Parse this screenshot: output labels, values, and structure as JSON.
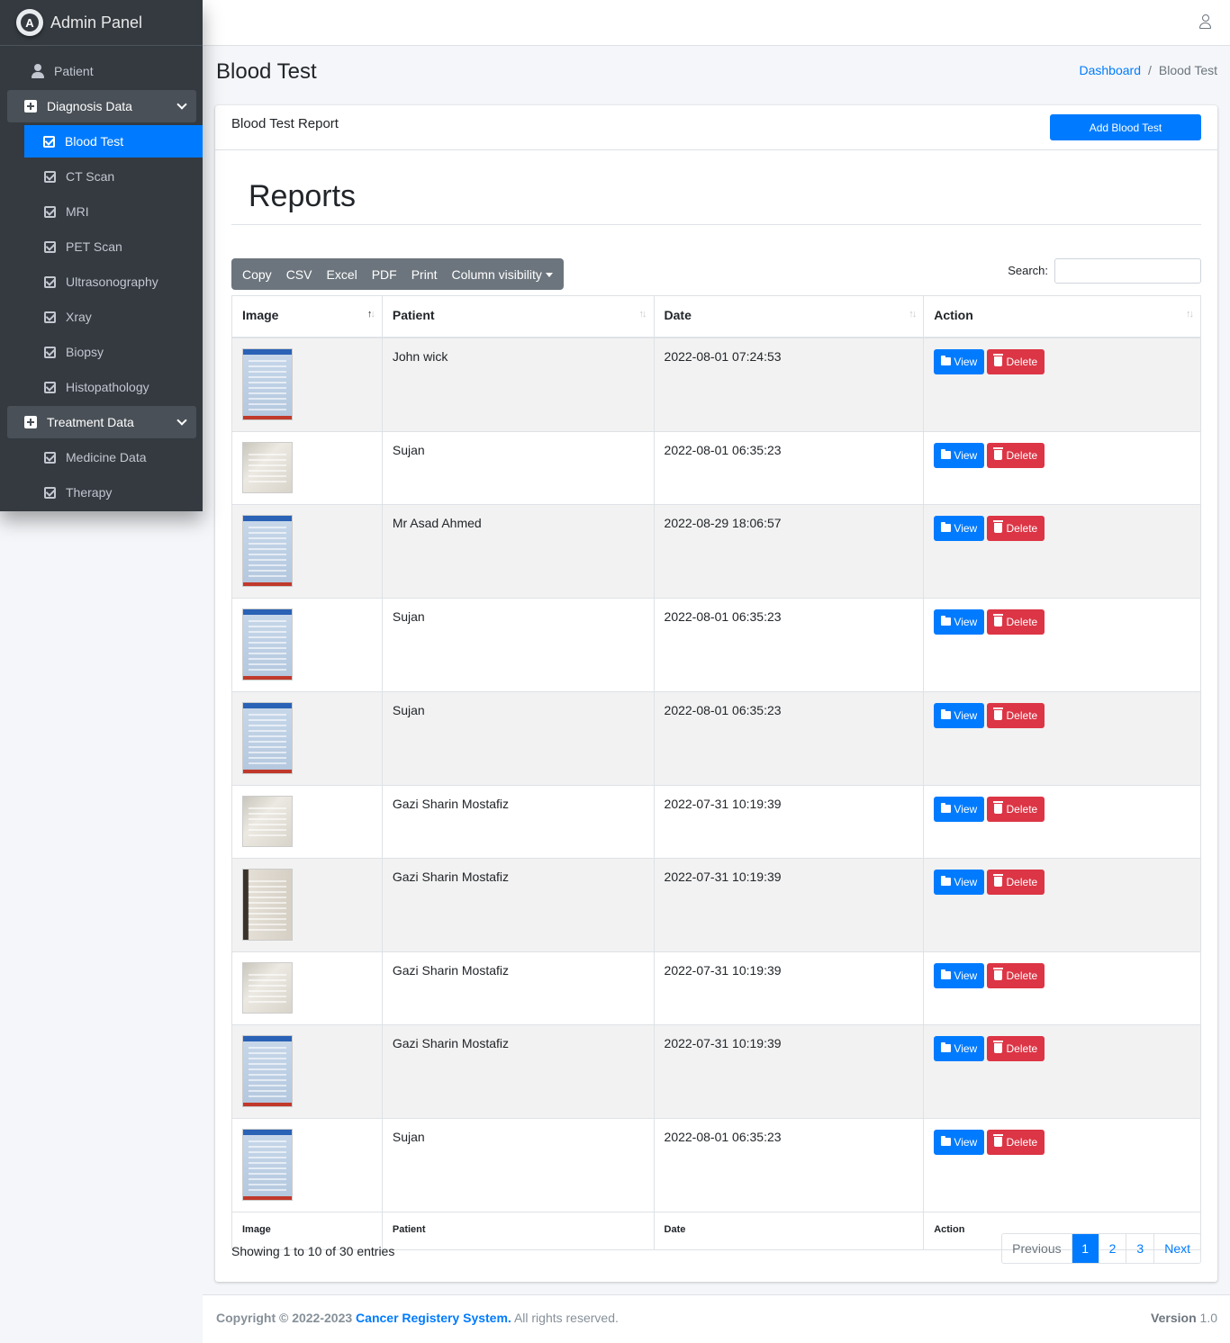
{
  "brand": {
    "name": "Admin Panel",
    "logo_letter": "A"
  },
  "sidebar": {
    "patient": "Patient",
    "diagnosis_header": "Diagnosis Data",
    "diagnosis_items": [
      "Blood Test",
      "CT Scan",
      "MRI",
      "PET Scan",
      "Ultrasonography",
      "Xray",
      "Biopsy",
      "Histopathology"
    ],
    "treatment_header": "Treatment Data",
    "treatment_items": [
      "Medicine Data",
      "Therapy"
    ]
  },
  "header": {
    "title": "Blood Test",
    "breadcrumb": {
      "home": "Dashboard",
      "sep": "/",
      "current": "Blood Test"
    }
  },
  "card": {
    "title": "Blood Test Report",
    "add_button": "Add Blood Test",
    "reports_title": "Reports"
  },
  "toolbar": {
    "buttons": [
      "Copy",
      "CSV",
      "Excel",
      "PDF",
      "Print",
      "Column visibility"
    ],
    "search_label": "Search:"
  },
  "table": {
    "columns": [
      "Image",
      "Patient",
      "Date",
      "Action"
    ],
    "rows": [
      {
        "patient": "John wick",
        "date": "2022-08-01 07:24:53",
        "thumb": "blue"
      },
      {
        "patient": "Sujan",
        "date": "2022-08-01 06:35:23",
        "thumb": "photo"
      },
      {
        "patient": "Mr Asad Ahmed",
        "date": "2022-08-29 18:06:57",
        "thumb": "blue"
      },
      {
        "patient": "Sujan",
        "date": "2022-08-01 06:35:23",
        "thumb": "blue"
      },
      {
        "patient": "Sujan",
        "date": "2022-08-01 06:35:23",
        "thumb": "blue"
      },
      {
        "patient": "Gazi Sharin Mostafiz",
        "date": "2022-07-31 10:19:39",
        "thumb": "photo"
      },
      {
        "patient": "Gazi Sharin Mostafiz",
        "date": "2022-07-31 10:19:39",
        "thumb": "dark"
      },
      {
        "patient": "Gazi Sharin Mostafiz",
        "date": "2022-07-31 10:19:39",
        "thumb": "photo"
      },
      {
        "patient": "Gazi Sharin Mostafiz",
        "date": "2022-07-31 10:19:39",
        "thumb": "blue"
      },
      {
        "patient": "Sujan",
        "date": "2022-08-01 06:35:23",
        "thumb": "blue"
      }
    ],
    "view_label": "View",
    "delete_label": "Delete"
  },
  "info": "Showing 1 to 10 of 30 entries",
  "pagination": {
    "previous": "Previous",
    "pages": [
      "1",
      "2",
      "3"
    ],
    "current": "1",
    "next": "Next"
  },
  "footer": {
    "copyright_prefix": "Copyright © 2022-2023",
    "org": "Cancer Registery System.",
    "rights": "All rights reserved.",
    "version_label": "Version",
    "version": "1.0"
  },
  "colors": {
    "primary": "#007bff",
    "danger": "#dc3545",
    "sidebar": "#343a40"
  }
}
